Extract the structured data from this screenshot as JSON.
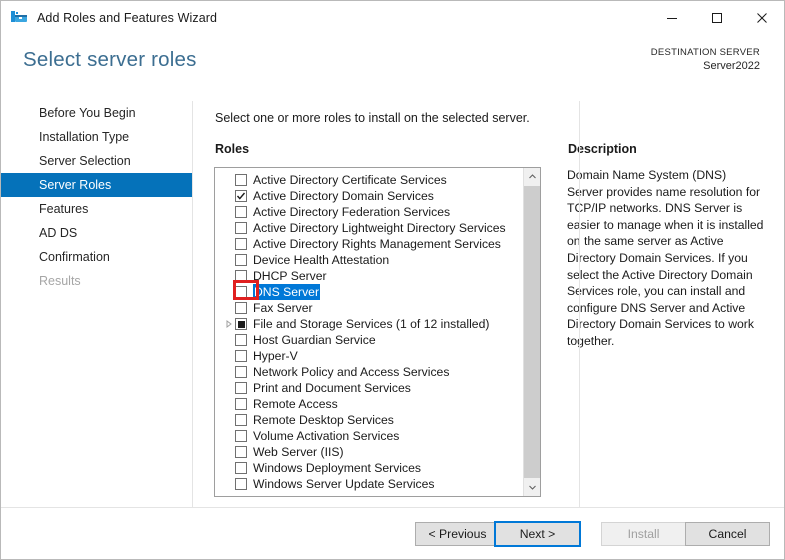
{
  "window": {
    "title": "Add Roles and Features Wizard",
    "icon": "roles-features-wizard-icon",
    "controls": {
      "minimize": "minimize-icon",
      "maximize": "maximize-icon",
      "close": "close-icon"
    }
  },
  "header": {
    "page_title": "Select server roles",
    "destination_label": "DESTINATION SERVER",
    "destination_server": "Server2022"
  },
  "sidebar": {
    "items": [
      {
        "label": "Before You Begin",
        "state": "normal"
      },
      {
        "label": "Installation Type",
        "state": "normal"
      },
      {
        "label": "Server Selection",
        "state": "normal"
      },
      {
        "label": "Server Roles",
        "state": "selected"
      },
      {
        "label": "Features",
        "state": "normal"
      },
      {
        "label": "AD DS",
        "state": "normal"
      },
      {
        "label": "Confirmation",
        "state": "normal"
      },
      {
        "label": "Results",
        "state": "disabled"
      }
    ],
    "selected_color": "#0572ba"
  },
  "main": {
    "instruction": "Select one or more roles to install on the selected server.",
    "roles_label": "Roles",
    "description_label": "Description",
    "description_text": "Domain Name System (DNS) Server provides name resolution for TCP/IP networks. DNS Server is easier to manage when it is installed on the same server as Active Directory Domain Services. If you select the Active Directory Domain Services role, you can install and configure DNS Server and Active Directory Domain Services to work together.",
    "roles": [
      {
        "label": "Active Directory Certificate Services",
        "checked": false,
        "partial": false,
        "expandable": false,
        "highlighted": false,
        "annotated": false
      },
      {
        "label": "Active Directory Domain Services",
        "checked": true,
        "partial": false,
        "expandable": false,
        "highlighted": false,
        "annotated": false
      },
      {
        "label": "Active Directory Federation Services",
        "checked": false,
        "partial": false,
        "expandable": false,
        "highlighted": false,
        "annotated": false
      },
      {
        "label": "Active Directory Lightweight Directory Services",
        "checked": false,
        "partial": false,
        "expandable": false,
        "highlighted": false,
        "annotated": false
      },
      {
        "label": "Active Directory Rights Management Services",
        "checked": false,
        "partial": false,
        "expandable": false,
        "highlighted": false,
        "annotated": false
      },
      {
        "label": "Device Health Attestation",
        "checked": false,
        "partial": false,
        "expandable": false,
        "highlighted": false,
        "annotated": false
      },
      {
        "label": "DHCP Server",
        "checked": false,
        "partial": false,
        "expandable": false,
        "highlighted": false,
        "annotated": false
      },
      {
        "label": "DNS Server",
        "checked": false,
        "partial": false,
        "expandable": false,
        "highlighted": true,
        "annotated": true
      },
      {
        "label": "Fax Server",
        "checked": false,
        "partial": false,
        "expandable": false,
        "highlighted": false,
        "annotated": false
      },
      {
        "label": "File and Storage Services (1 of 12 installed)",
        "checked": false,
        "partial": true,
        "expandable": true,
        "highlighted": false,
        "annotated": false
      },
      {
        "label": "Host Guardian Service",
        "checked": false,
        "partial": false,
        "expandable": false,
        "highlighted": false,
        "annotated": false
      },
      {
        "label": "Hyper-V",
        "checked": false,
        "partial": false,
        "expandable": false,
        "highlighted": false,
        "annotated": false
      },
      {
        "label": "Network Policy and Access Services",
        "checked": false,
        "partial": false,
        "expandable": false,
        "highlighted": false,
        "annotated": false
      },
      {
        "label": "Print and Document Services",
        "checked": false,
        "partial": false,
        "expandable": false,
        "highlighted": false,
        "annotated": false
      },
      {
        "label": "Remote Access",
        "checked": false,
        "partial": false,
        "expandable": false,
        "highlighted": false,
        "annotated": false
      },
      {
        "label": "Remote Desktop Services",
        "checked": false,
        "partial": false,
        "expandable": false,
        "highlighted": false,
        "annotated": false
      },
      {
        "label": "Volume Activation Services",
        "checked": false,
        "partial": false,
        "expandable": false,
        "highlighted": false,
        "annotated": false
      },
      {
        "label": "Web Server (IIS)",
        "checked": false,
        "partial": false,
        "expandable": false,
        "highlighted": false,
        "annotated": false
      },
      {
        "label": "Windows Deployment Services",
        "checked": false,
        "partial": false,
        "expandable": false,
        "highlighted": false,
        "annotated": false
      },
      {
        "label": "Windows Server Update Services",
        "checked": false,
        "partial": false,
        "expandable": false,
        "highlighted": false,
        "annotated": false
      }
    ],
    "annotation_color": "#e02020",
    "selection_color": "#0078d7"
  },
  "footer": {
    "previous_label": "< Previous",
    "next_label": "Next >",
    "install_label": "Install",
    "cancel_label": "Cancel",
    "install_enabled": false,
    "focus_color": "#0078d7"
  }
}
